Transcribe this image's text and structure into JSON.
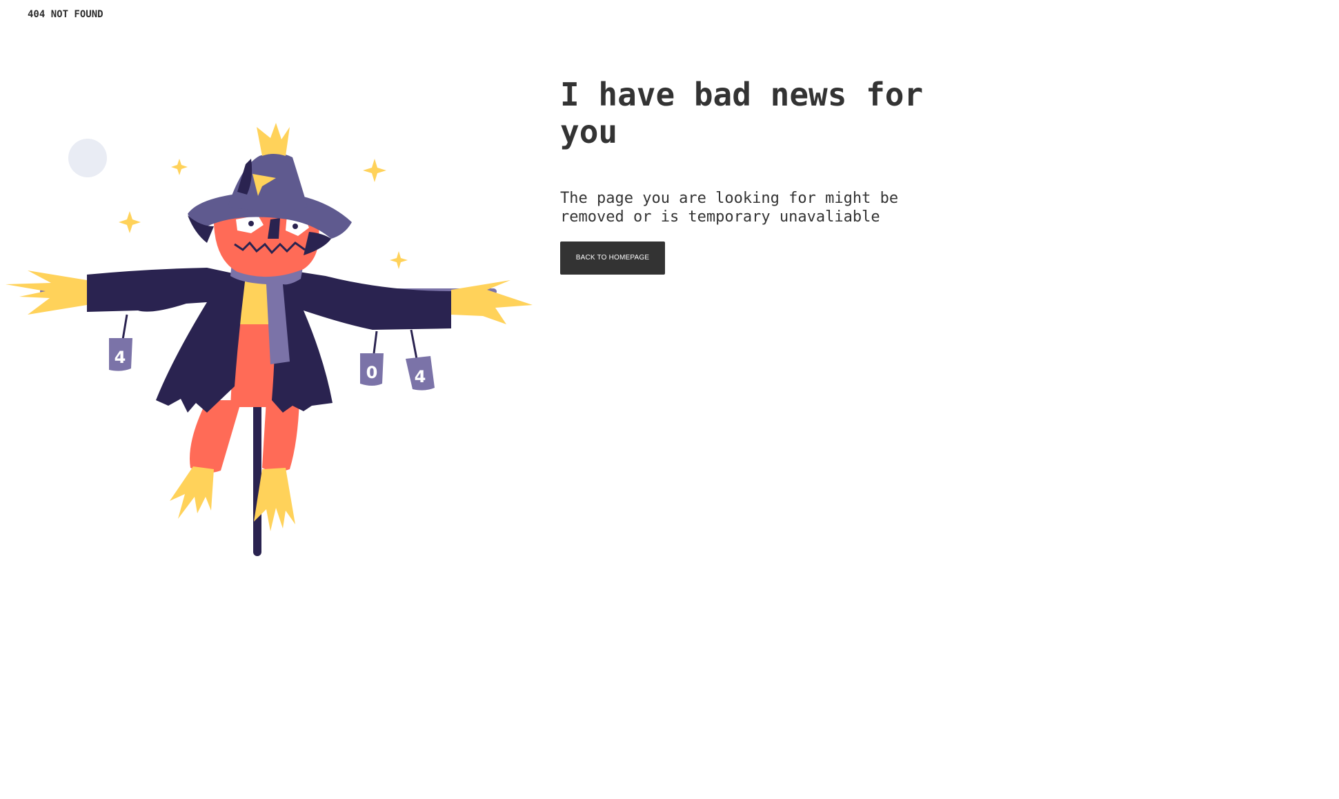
{
  "header": {
    "brand": "404 NOT FOUND"
  },
  "main": {
    "heading": "I have bad news for you",
    "message": "The page you are looking for might be removed or is temporary unavaliable",
    "button_label": "BACK TO HOMEPAGE"
  },
  "illustration": {
    "cans": [
      "4",
      "0",
      "4"
    ]
  },
  "colors": {
    "text": "#333333",
    "button_bg": "#333333",
    "button_text": "#ffffff",
    "hat": "#5f5a8f",
    "face": "#ff6b57",
    "coat": "#2a2350",
    "straw": "#ffd25a",
    "scarf": "#7b73a8",
    "moon": "#e9ecf4"
  }
}
